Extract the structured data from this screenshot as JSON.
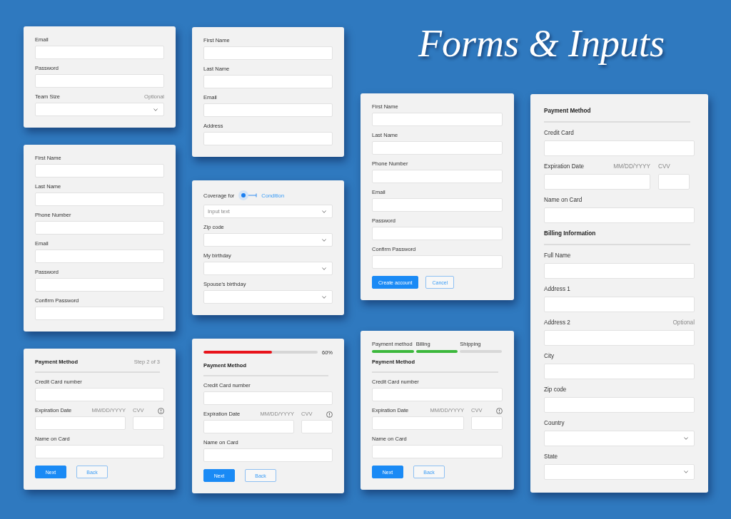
{
  "title": "Forms & Inputs",
  "columns": [
    {
      "cards": [
        {
          "rows": [
            {
              "kind": "input",
              "label": "Email"
            },
            {
              "kind": "input",
              "label": "Password"
            },
            {
              "kind": "select",
              "label": "Team Size",
              "note": "Optional"
            }
          ]
        },
        {
          "rows": [
            {
              "kind": "input",
              "label": "First Name"
            },
            {
              "kind": "input",
              "label": "Last Name"
            },
            {
              "kind": "input",
              "label": "Phone Number"
            },
            {
              "kind": "input",
              "label": "Email"
            },
            {
              "kind": "input",
              "label": "Password"
            },
            {
              "kind": "input",
              "label": "Confirm Password"
            }
          ]
        },
        {
          "rows": [
            {
              "kind": "heading",
              "text": "Payment Method",
              "note": "Step 2 of 3"
            },
            {
              "kind": "input",
              "label": "Credit Card number"
            },
            {
              "kind": "split",
              "label": "Expiration Date",
              "hint": "MM/DD/YYYY",
              "label2": "CVV",
              "info": true
            },
            {
              "kind": "input",
              "label": "Name on Card"
            }
          ],
          "buttons": [
            {
              "label": "Next",
              "kind": "primary"
            },
            {
              "label": "Back",
              "kind": "secondary"
            }
          ]
        }
      ]
    },
    {
      "cards": [
        {
          "rows": [
            {
              "kind": "input",
              "label": "First Name"
            },
            {
              "kind": "input",
              "label": "Last Name"
            },
            {
              "kind": "input",
              "label": "Email"
            },
            {
              "kind": "input",
              "label": "Address"
            }
          ]
        },
        {
          "rows": [
            {
              "kind": "switch",
              "label": "Coverage for",
              "option": "Condition",
              "on": false
            },
            {
              "kind": "select",
              "placeholder": "Input text"
            },
            {
              "kind": "select",
              "label": "Zip code"
            },
            {
              "kind": "select",
              "label": "My birthday"
            },
            {
              "kind": "select",
              "label": "Spouse's birthday"
            }
          ]
        },
        {
          "progress": {
            "level": 0.6,
            "reading": "60%"
          },
          "rows": [
            {
              "kind": "heading",
              "text": "Payment Method"
            },
            {
              "kind": "input",
              "label": "Credit Card number"
            },
            {
              "kind": "split",
              "label": "Expiration Date",
              "hint": "MM/DD/YYYY",
              "label2": "CVV",
              "info": true
            },
            {
              "kind": "input",
              "label": "Name on Card"
            }
          ],
          "buttons": [
            {
              "label": "Next",
              "kind": "primary"
            },
            {
              "label": "Back",
              "kind": "secondary"
            }
          ]
        }
      ]
    },
    {
      "cards": [
        {
          "rows": [
            {
              "kind": "input",
              "label": "First Name"
            },
            {
              "kind": "input",
              "label": "Last Name"
            },
            {
              "kind": "input",
              "label": "Phone Number"
            },
            {
              "kind": "input",
              "label": "Email"
            },
            {
              "kind": "input",
              "label": "Password"
            },
            {
              "kind": "input",
              "label": "Confirm Password"
            }
          ],
          "buttons": [
            {
              "label": "Create account",
              "kind": "primary"
            },
            {
              "label": "Cancel",
              "kind": "secondary"
            }
          ]
        },
        {
          "steps": [
            {
              "label": "Payment method",
              "done": true
            },
            {
              "label": "Billing",
              "done": true
            },
            {
              "label": "Shipping",
              "done": false
            }
          ],
          "rows": [
            {
              "kind": "heading",
              "text": "Payment Method"
            },
            {
              "kind": "input",
              "label": "Credit Card number"
            },
            {
              "kind": "split",
              "label": "Expiration Date",
              "hint": "MM/DD/YYYY",
              "label2": "CVV",
              "info": true
            },
            {
              "kind": "input",
              "label": "Name on Card"
            }
          ],
          "buttons": [
            {
              "label": "Next",
              "kind": "primary"
            },
            {
              "label": "Back",
              "kind": "secondary"
            }
          ]
        }
      ]
    },
    {
      "cards": [
        {
          "rows": [
            {
              "kind": "heading",
              "text": "Payment Method"
            },
            {
              "kind": "input",
              "label": "Credit Card"
            },
            {
              "kind": "split",
              "label": "Expiration Date",
              "hint": "MM/DD/YYYY",
              "label2": "CVV"
            },
            {
              "kind": "input",
              "label": "Name on Card"
            },
            {
              "kind": "heading",
              "text": "Billing Information"
            },
            {
              "kind": "input",
              "label": "Full Name"
            },
            {
              "kind": "input",
              "label": "Address 1"
            },
            {
              "kind": "input",
              "label": "Address 2",
              "note": "Optional"
            },
            {
              "kind": "input",
              "label": "City"
            },
            {
              "kind": "input",
              "label": "Zip code"
            },
            {
              "kind": "select",
              "label": "Country"
            },
            {
              "kind": "select",
              "label": "State"
            }
          ]
        }
      ]
    }
  ]
}
